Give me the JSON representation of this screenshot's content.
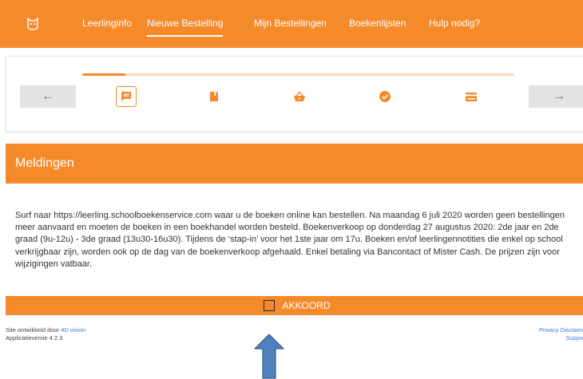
{
  "nav": {
    "items": [
      {
        "label": "Leerlinginfo"
      },
      {
        "label": "Nieuwe Bestelling"
      },
      {
        "label": "Mijn Bestellingen"
      },
      {
        "label": "Boekenlijsten"
      },
      {
        "label": "Hulp nodig?"
      }
    ],
    "active_index": 1
  },
  "stepper": {
    "prev_icon": "←",
    "next_icon": "→",
    "progress_fraction": 0.1,
    "steps": [
      {
        "icon": "message-icon",
        "active": true
      },
      {
        "icon": "book-icon",
        "active": false
      },
      {
        "icon": "basket-icon",
        "active": false
      },
      {
        "icon": "check-circle-icon",
        "active": false
      },
      {
        "icon": "credit-card-icon",
        "active": false
      }
    ]
  },
  "section": {
    "title": "Meldingen"
  },
  "message": {
    "text": "Surf naar https://leerling.schoolboekenservice.com waar u de boeken online kan bestellen. Na maandag 6 juli 2020 worden geen bestellingen meer aanvaard en moeten de boeken in een boekhandel worden besteld. Boekenverkoop op donderdag 27 augustus 2020: 2de jaar en 2de graad (9u-12u) - 3de graad (13u30-16u30). Tijdens de ‘stap-in’ voor het 1ste jaar om 17u. Boeken en/of leerlingennotities die enkel op school verkrijgbaar zijn, worden ook op de dag van de boekenverkoop afgehaald. Enkel betaling via Bancontact of Mister Cash. De prijzen zijn voor wijzigingen vatbaar."
  },
  "akkoord": {
    "label": "AKKOORD",
    "checked": false
  },
  "footer": {
    "developed_by": "Site ontwikkeld door",
    "developer": "4D vision",
    "version": "Applicatieversie 4.2.3",
    "privacy": "Privacy Disclaim",
    "support": "Suppo"
  },
  "colors": {
    "brand": "#f58a2b",
    "progress_track": "#f7d9bf",
    "arrow_button": "#e3e3e3",
    "annotation": "#4f81bd"
  }
}
